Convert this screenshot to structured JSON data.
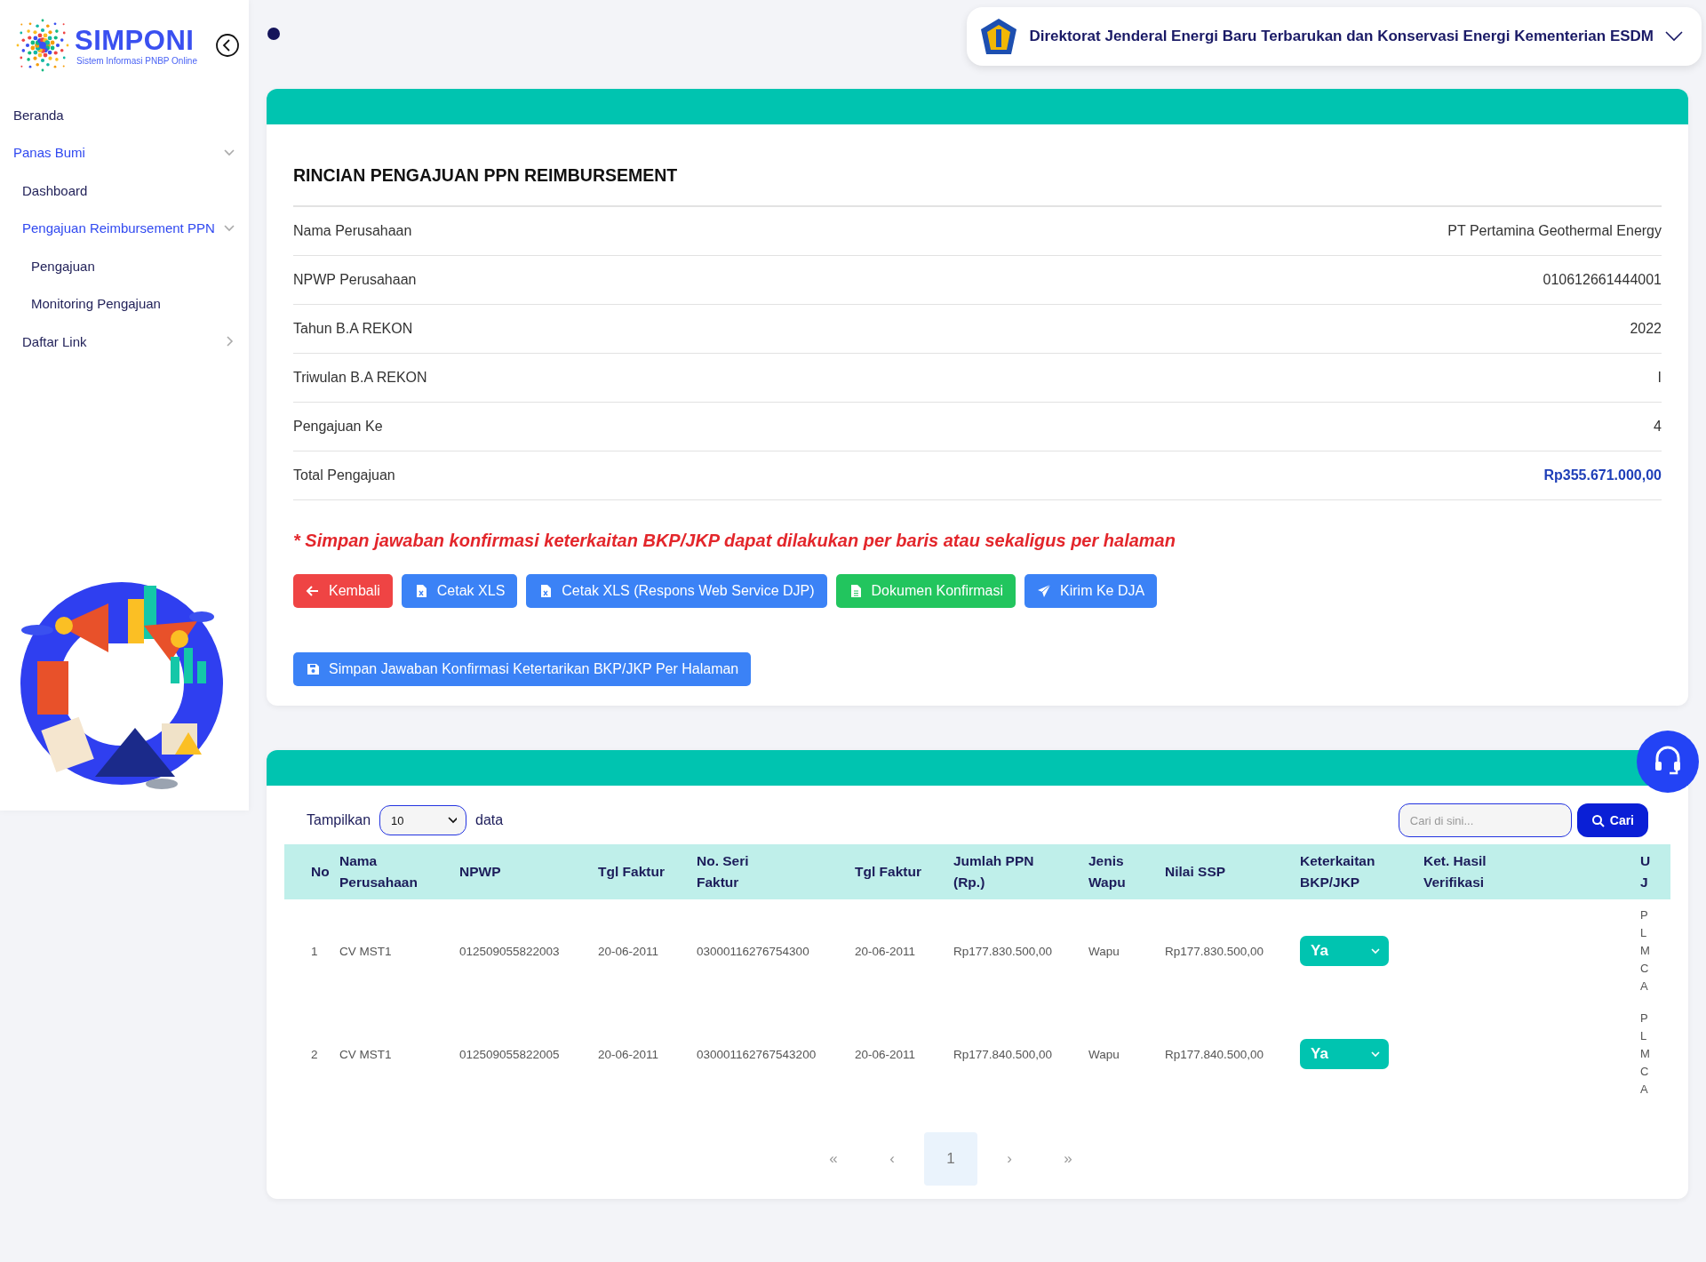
{
  "logo": {
    "title": "SIMPONI",
    "subtitle": "Sistem Informasi PNBP Online"
  },
  "sidebar": {
    "items": [
      {
        "label": "Beranda",
        "selected": false
      },
      {
        "label": "Panas Bumi",
        "selected": true,
        "expanded": true,
        "children": [
          {
            "label": "Dashboard",
            "selected": false
          },
          {
            "label": "Pengajuan Reimbursement PPN",
            "selected": true,
            "expanded": true,
            "children": [
              {
                "label": "Pengajuan",
                "selected": false
              },
              {
                "label": "Monitoring Pengajuan",
                "selected": false
              }
            ]
          },
          {
            "label": "Daftar Link",
            "selected": false,
            "expanded": false
          }
        ]
      }
    ]
  },
  "header": {
    "organization": "Direktorat Jenderal Energi Baru Terbarukan dan Konservasi Energi Kementerian ESDM"
  },
  "detail": {
    "title": "RINCIAN PENGAJUAN PPN REIMBURSEMENT",
    "fields": [
      {
        "label": "Nama Perusahaan",
        "value": "PT Pertamina Geothermal Energy",
        "highlight": false
      },
      {
        "label": "NPWP Perusahaan",
        "value": "010612661444001",
        "highlight": false
      },
      {
        "label": "Tahun B.A REKON",
        "value": "2022",
        "highlight": false
      },
      {
        "label": "Triwulan B.A REKON",
        "value": "I",
        "highlight": false
      },
      {
        "label": "Pengajuan Ke",
        "value": "4",
        "highlight": false
      },
      {
        "label": "Total Pengajuan",
        "value": "Rp355.671.000,00",
        "highlight": true
      }
    ],
    "note": "* Simpan jawaban konfirmasi keterkaitan BKP/JKP dapat dilakukan per baris atau sekaligus per halaman",
    "buttons": [
      {
        "label": "Kembali",
        "kind": "back"
      },
      {
        "label": "Cetak XLS",
        "kind": "export"
      },
      {
        "label": "Cetak XLS (Respons Web Service DJP)",
        "kind": "export"
      },
      {
        "label": "Dokumen Konfirmasi",
        "kind": "document"
      },
      {
        "label": "Kirim Ke DJA",
        "kind": "send"
      }
    ],
    "save_button": {
      "label": "Simpan Jawaban Konfirmasi Ketertarikan BKP/JKP Per Halaman",
      "kind": "save"
    }
  },
  "table": {
    "length_prefix": "Tampilkan",
    "page_size": "10",
    "length_suffix": "data",
    "search": {
      "placeholder": "Cari di sini...",
      "button": "Cari"
    },
    "columns": [
      "No",
      "Nama Perusahaan",
      "NPWP",
      "Tgl Faktur",
      "No. Seri Faktur",
      "Tgl Faktur",
      "Jumlah PPN (Rp.)",
      "Jenis Wapu",
      "Nilai SSP",
      "Keterkaitan BKP/JKP",
      "Ket. Hasil Verifikasi",
      "U J"
    ],
    "rows": [
      {
        "no": "1",
        "nama": "CV MST1",
        "npwp": "012509055822003",
        "tgl_faktur": "20-06-2011",
        "no_seri": "03000116276754300",
        "tgl_faktur_2": "20-06-2011",
        "jumlah_ppn": "Rp177.830.500,00",
        "jenis_wapu": "Wapu",
        "nilai_ssp": "Rp177.830.500,00",
        "keterkaitan": "Ya",
        "column_12": "P L M C A"
      },
      {
        "no": "2",
        "nama": "CV MST1",
        "npwp": "012509055822005",
        "tgl_faktur": "20-06-2011",
        "no_seri": "030001162767543200",
        "tgl_faktur_2": "20-06-2011",
        "jumlah_ppn": "Rp177.840.500,00",
        "jenis_wapu": "Wapu",
        "nilai_ssp": "Rp177.840.500,00",
        "keterkaitan": "Ya",
        "column_12": "P L M C A"
      }
    ],
    "pagination": [
      {
        "label": "«",
        "selected": false
      },
      {
        "label": "‹",
        "selected": false
      },
      {
        "label": "1",
        "selected": true
      },
      {
        "label": "›",
        "selected": false
      },
      {
        "label": "»",
        "selected": false
      }
    ]
  }
}
